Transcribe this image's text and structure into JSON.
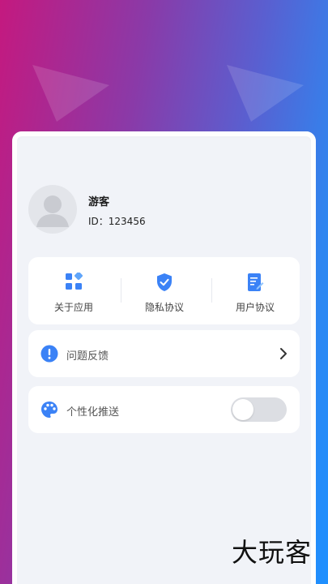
{
  "user": {
    "name": "游客",
    "id_text": "ID：123456"
  },
  "shortcuts": [
    {
      "label": "关于应用",
      "icon": "apps-icon"
    },
    {
      "label": "隐私协议",
      "icon": "shield-check-icon"
    },
    {
      "label": "用户协议",
      "icon": "document-edit-icon"
    }
  ],
  "feedback": {
    "label": "问题反馈",
    "icon": "exclamation-icon"
  },
  "personalized": {
    "label": "个性化推送",
    "icon": "palette-icon",
    "enabled": false
  },
  "watermark": "大玩客",
  "colors": {
    "accent": "#3b82f6",
    "toggle_off": "#dcdee3"
  }
}
